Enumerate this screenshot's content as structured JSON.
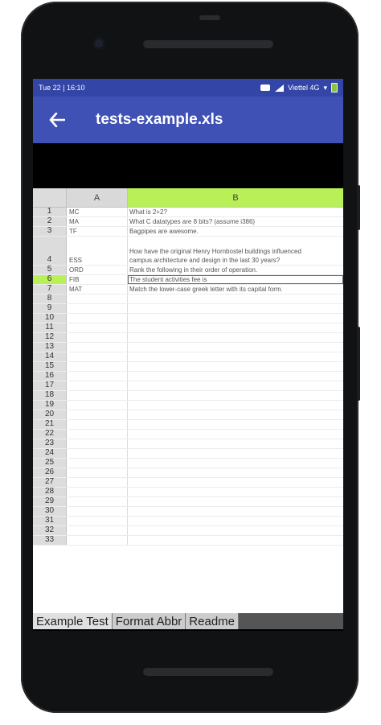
{
  "status_bar": {
    "time": "Tue 22 | 16:10",
    "carrier": "Viettel 4G"
  },
  "app_bar": {
    "title": "tests-example.xls",
    "back_icon": "arrow-left-icon"
  },
  "sheet": {
    "columns": [
      "A",
      "B"
    ],
    "selected_row": 6,
    "rows": [
      {
        "num": "1",
        "a": "MC",
        "b": "What is 2+2?"
      },
      {
        "num": "2",
        "a": "MA",
        "b": "What C datatypes are 8 bits? (assume i386)"
      },
      {
        "num": "3",
        "a": "TF",
        "b": "Bagpipes are awesome."
      },
      {
        "num": "4",
        "a": "ESS",
        "b": "How have the original Henry Hornbostel buildings influenced\ncampus architecture and design in the last 30 years?"
      },
      {
        "num": "5",
        "a": "ORD",
        "b": "Rank the following in their order of operation."
      },
      {
        "num": "6",
        "a": "FIB",
        "b": "The student activities fee is"
      },
      {
        "num": "7",
        "a": "MAT",
        "b": "Match the lower-case greek letter with its capital form."
      },
      {
        "num": "8",
        "a": "",
        "b": ""
      },
      {
        "num": "9",
        "a": "",
        "b": ""
      },
      {
        "num": "10",
        "a": "",
        "b": ""
      },
      {
        "num": "11",
        "a": "",
        "b": ""
      },
      {
        "num": "12",
        "a": "",
        "b": ""
      },
      {
        "num": "13",
        "a": "",
        "b": ""
      },
      {
        "num": "14",
        "a": "",
        "b": ""
      },
      {
        "num": "15",
        "a": "",
        "b": ""
      },
      {
        "num": "16",
        "a": "",
        "b": ""
      },
      {
        "num": "17",
        "a": "",
        "b": ""
      },
      {
        "num": "18",
        "a": "",
        "b": ""
      },
      {
        "num": "19",
        "a": "",
        "b": ""
      },
      {
        "num": "20",
        "a": "",
        "b": ""
      },
      {
        "num": "21",
        "a": "",
        "b": ""
      },
      {
        "num": "22",
        "a": "",
        "b": ""
      },
      {
        "num": "23",
        "a": "",
        "b": ""
      },
      {
        "num": "24",
        "a": "",
        "b": ""
      },
      {
        "num": "25",
        "a": "",
        "b": ""
      },
      {
        "num": "26",
        "a": "",
        "b": ""
      },
      {
        "num": "27",
        "a": "",
        "b": ""
      },
      {
        "num": "28",
        "a": "",
        "b": ""
      },
      {
        "num": "29",
        "a": "",
        "b": ""
      },
      {
        "num": "30",
        "a": "",
        "b": ""
      },
      {
        "num": "31",
        "a": "",
        "b": ""
      },
      {
        "num": "32",
        "a": "",
        "b": ""
      },
      {
        "num": "33",
        "a": "",
        "b": ""
      }
    ]
  },
  "sheet_tabs": [
    "Example Test",
    "Format Abbr",
    "Readme"
  ],
  "colors": {
    "status_bar": "#3345a6",
    "app_bar": "#3f51b5",
    "selected_highlight": "#b9ef57"
  }
}
